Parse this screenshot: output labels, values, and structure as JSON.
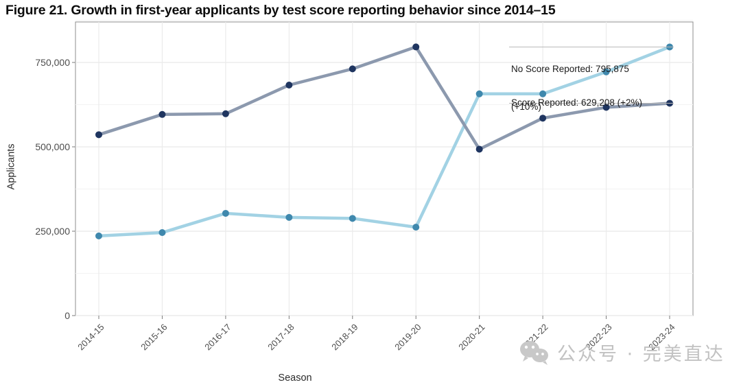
{
  "figure": {
    "title": "Figure 21. Growth in first-year applicants by test score reporting behavior since 2014–15"
  },
  "watermark": {
    "icon": "wechat-icon",
    "text": "公众号 · 完美直达"
  },
  "annotations": {
    "no_score_line1": "No Score Reported: 795,875",
    "no_score_line2": "(+10%)",
    "score": "Score Reported: 629,208 (+2%)"
  },
  "colors": {
    "no_score_marker": "#3f88ad",
    "no_score_line": "#a2d2e4",
    "score_marker": "#1f3560",
    "score_line": "#8c99ae",
    "grid": "#ebebeb",
    "panel_border": "#8d8d8d",
    "background": "#ffffff"
  },
  "chart_data": {
    "type": "line",
    "title": "Figure 21. Growth in first-year applicants by test score reporting behavior since 2014–15",
    "xlabel": "Season",
    "ylabel": "Applicants",
    "categories": [
      "2014-15",
      "2015-16",
      "2016-17",
      "2017-18",
      "2018-19",
      "2019-20",
      "2020-21",
      "2021-22",
      "2022-23",
      "2023-24"
    ],
    "ylim": [
      0,
      870000
    ],
    "yticks": [
      0,
      250000,
      500000,
      750000
    ],
    "ytick_labels": [
      "0",
      "250,000",
      "500,000",
      "750,000"
    ],
    "grid": true,
    "legend": "none",
    "series": [
      {
        "name": "No Score Reported",
        "color": "#a2d2e4",
        "marker_color": "#3f88ad",
        "values": [
          236000,
          246000,
          303000,
          291000,
          288000,
          262000,
          657000,
          657000,
          722000,
          795875
        ]
      },
      {
        "name": "Score Reported",
        "color": "#8c99ae",
        "marker_color": "#1f3560",
        "values": [
          536000,
          596000,
          598000,
          683000,
          731000,
          796000,
          493000,
          585000,
          617000,
          629208
        ]
      }
    ]
  }
}
